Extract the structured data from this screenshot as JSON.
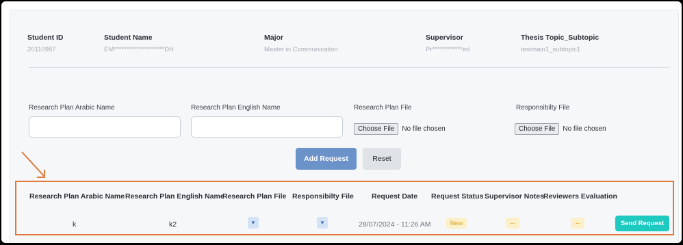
{
  "student": {
    "id_label": "Student ID",
    "id_value": "20110987",
    "name_label": "Student Name",
    "name_value": "EM********************DH",
    "major_label": "Major",
    "major_value": "Master in Communication",
    "supervisor_label": "Supervisor",
    "supervisor_value": "Pr************ed",
    "topic_label": "Thesis Topic_Subtopic",
    "topic_value": "testmain1_subtopic1"
  },
  "form": {
    "arabic_name_label": "Research Plan Arabic Name",
    "english_name_label": "Research Plan English Name",
    "plan_file_label": "Research Plan File",
    "resp_file_label": "Responsibilty File",
    "choose_file": "Choose File",
    "no_file": "No file chosen",
    "add_request": "Add Request",
    "reset": "Reset"
  },
  "table": {
    "headers": [
      "Research Plan Arabic Name",
      "Research Plan English Name",
      "Research Plan File",
      "Responsibilty File",
      "Request Date",
      "Request Status",
      "Supervisor Notes",
      "Reviewers Evaluation"
    ],
    "row": {
      "arabic_name": "k",
      "english_name": "k2",
      "request_date": "28/07/2024 - 11:26 AM",
      "status": "New",
      "supervisor_notes": "--",
      "reviewers_evaluation": "--",
      "action": "Send Request"
    }
  },
  "icons": {
    "file_download": "download-file-icon",
    "annotation_arrow": "arrow-icon"
  },
  "colors": {
    "primary": "#6b93c9",
    "send": "#1ec9c0",
    "highlight": "#e0793b",
    "badge_text": "#e8b54a"
  }
}
